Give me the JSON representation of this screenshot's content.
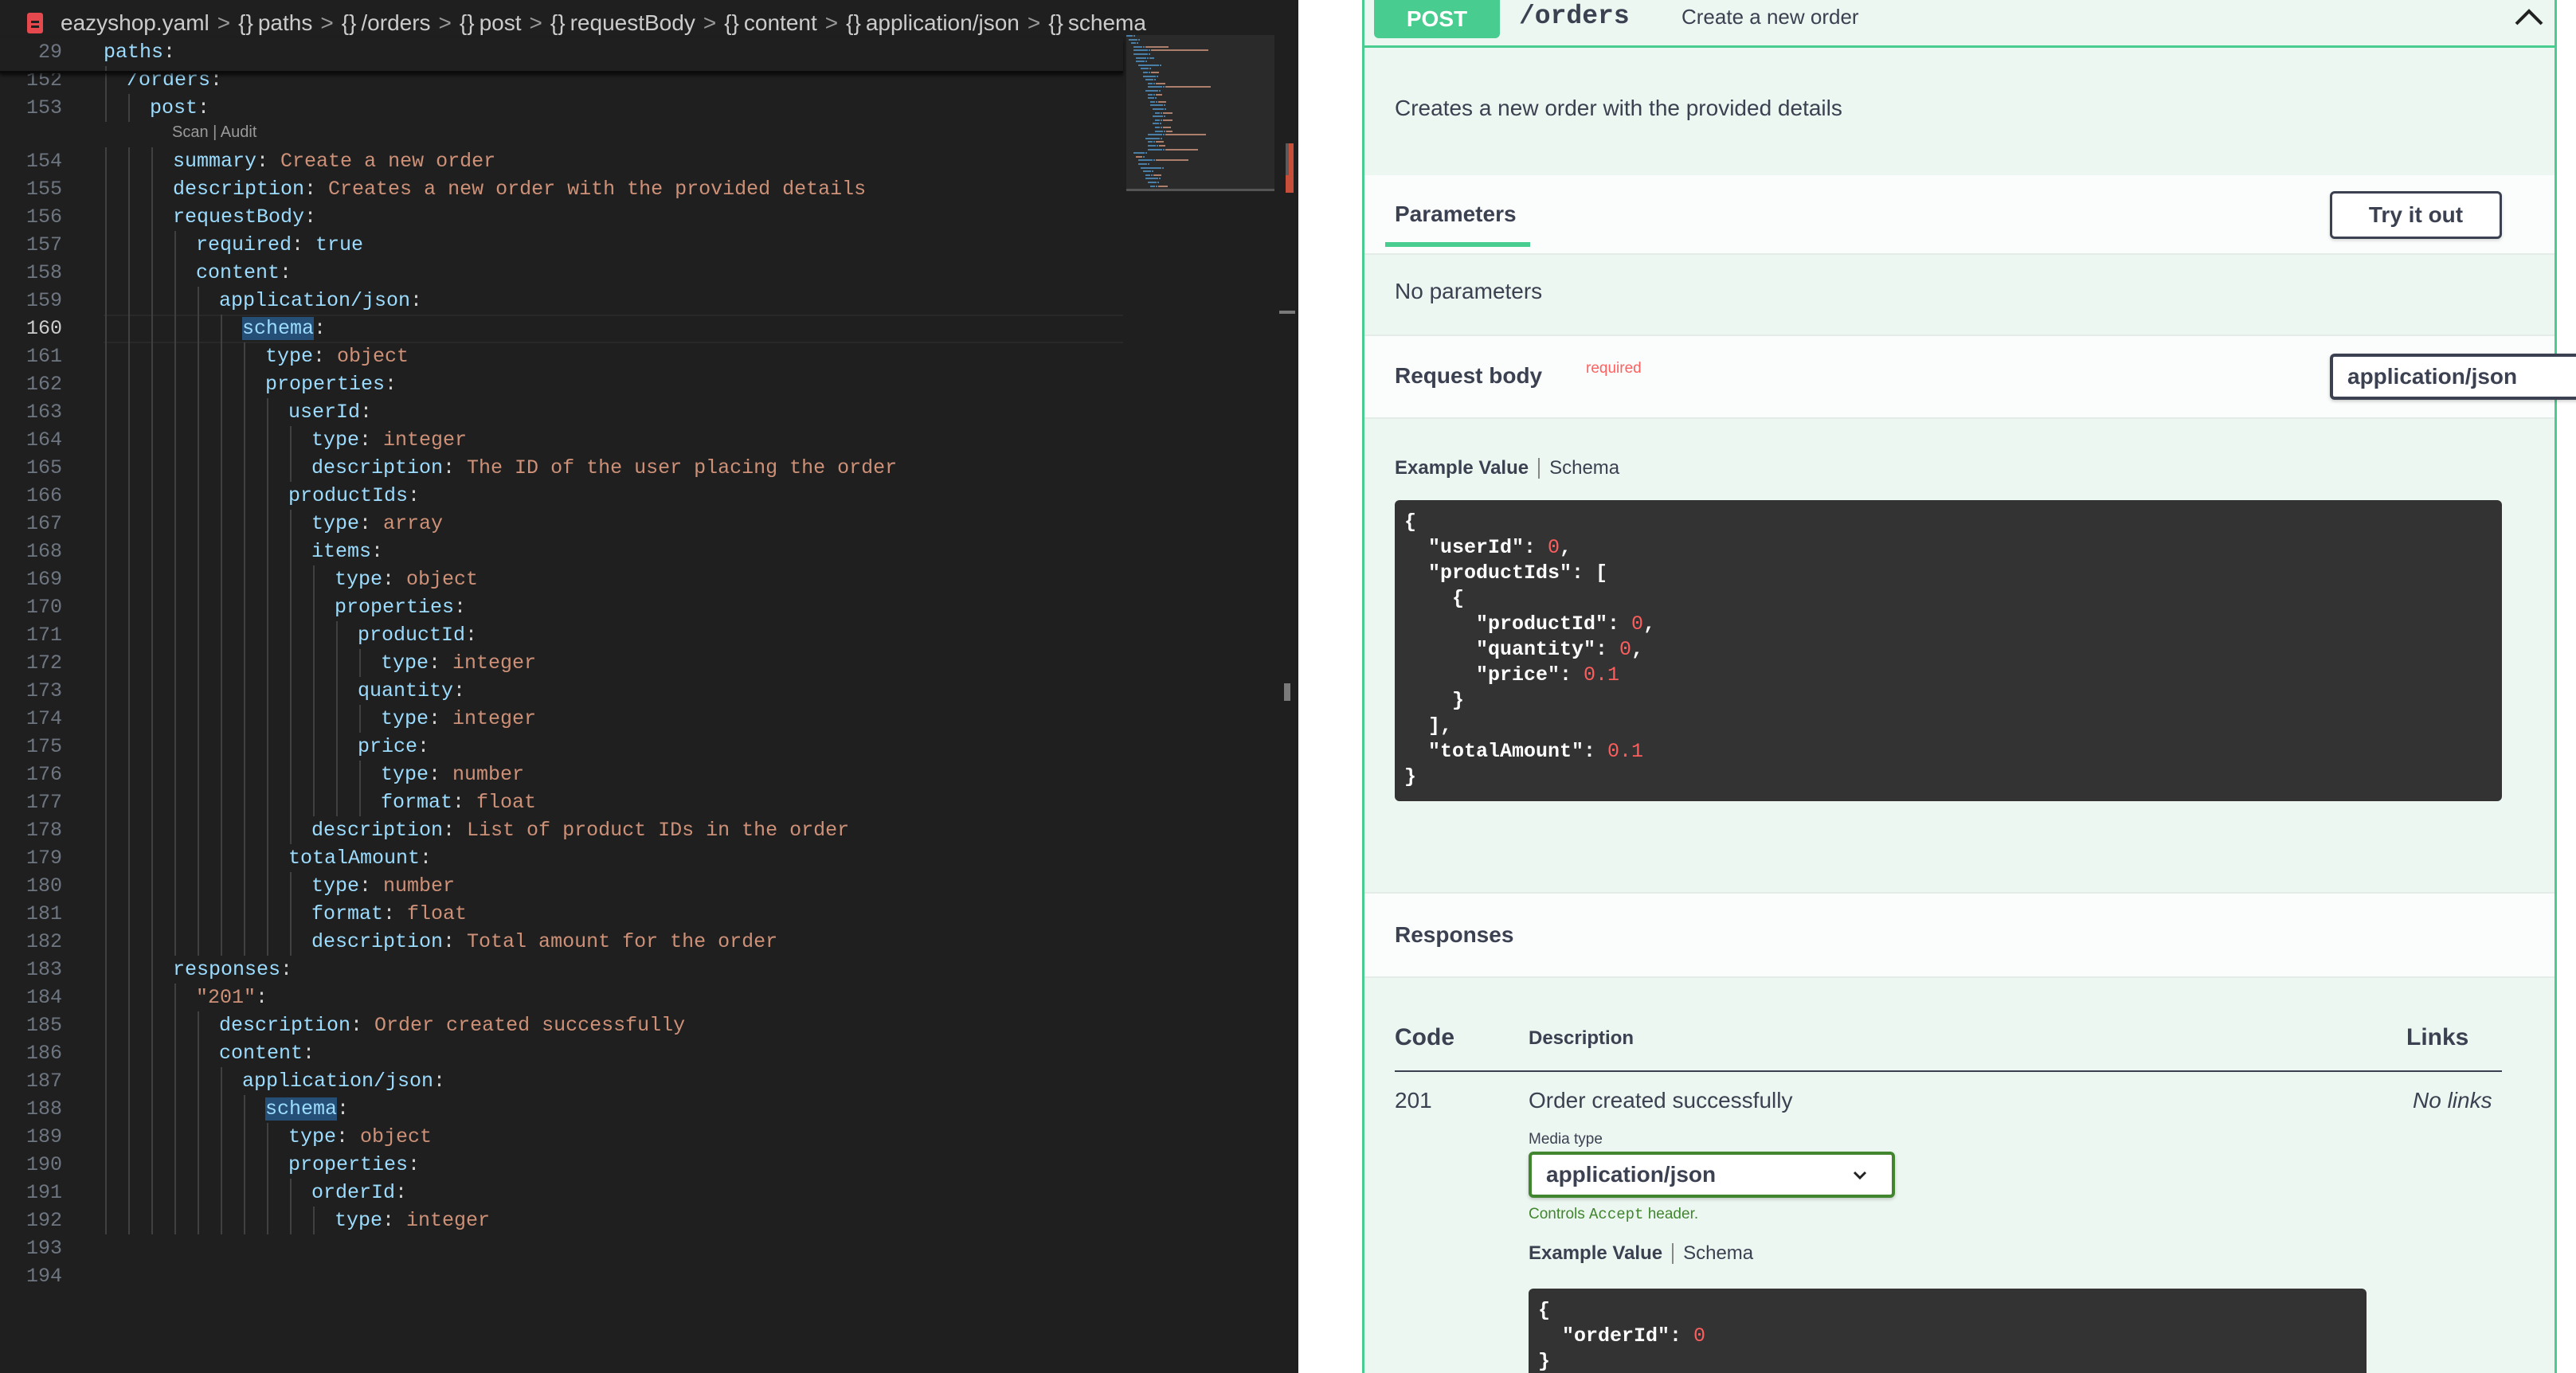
{
  "breadcrumb": {
    "file": "eazyshop.yaml",
    "items": [
      "paths",
      "/orders",
      "post",
      "requestBody",
      "content",
      "application/json",
      "schema"
    ]
  },
  "code_lens": "Scan | Audit",
  "editor_lines": [
    {
      "num": "29",
      "indent": 0,
      "segments": [
        [
          "k",
          "paths"
        ],
        [
          "p",
          ":"
        ]
      ]
    },
    {
      "num": "152",
      "indent": 1,
      "segments": [
        [
          "k",
          "/orders"
        ],
        [
          "p",
          ":"
        ]
      ]
    },
    {
      "num": "153",
      "indent": 2,
      "segments": [
        [
          "k",
          "post"
        ],
        [
          "p",
          ":"
        ]
      ]
    },
    {
      "num": "154",
      "indent": 3,
      "segments": [
        [
          "k",
          "summary"
        ],
        [
          "p",
          ": "
        ],
        [
          "v",
          "Create a new order"
        ]
      ]
    },
    {
      "num": "155",
      "indent": 3,
      "segments": [
        [
          "k",
          "description"
        ],
        [
          "p",
          ": "
        ],
        [
          "v",
          "Creates a new order with the provided details"
        ]
      ]
    },
    {
      "num": "156",
      "indent": 3,
      "segments": [
        [
          "k",
          "requestBody"
        ],
        [
          "p",
          ":"
        ]
      ]
    },
    {
      "num": "157",
      "indent": 4,
      "segments": [
        [
          "k",
          "required"
        ],
        [
          "p",
          ": "
        ],
        [
          "k",
          "true"
        ]
      ]
    },
    {
      "num": "158",
      "indent": 4,
      "segments": [
        [
          "k",
          "content"
        ],
        [
          "p",
          ":"
        ]
      ]
    },
    {
      "num": "159",
      "indent": 5,
      "segments": [
        [
          "k",
          "application/json"
        ],
        [
          "p",
          ":"
        ]
      ]
    },
    {
      "num": "160",
      "indent": 6,
      "segments": [
        [
          "ks",
          "schema"
        ],
        [
          "p",
          ":"
        ]
      ],
      "active": true
    },
    {
      "num": "161",
      "indent": 7,
      "segments": [
        [
          "k",
          "type"
        ],
        [
          "p",
          ": "
        ],
        [
          "v",
          "object"
        ]
      ]
    },
    {
      "num": "162",
      "indent": 7,
      "segments": [
        [
          "k",
          "properties"
        ],
        [
          "p",
          ":"
        ]
      ]
    },
    {
      "num": "163",
      "indent": 8,
      "segments": [
        [
          "k",
          "userId"
        ],
        [
          "p",
          ":"
        ]
      ]
    },
    {
      "num": "164",
      "indent": 9,
      "segments": [
        [
          "k",
          "type"
        ],
        [
          "p",
          ": "
        ],
        [
          "v",
          "integer"
        ]
      ]
    },
    {
      "num": "165",
      "indent": 9,
      "segments": [
        [
          "k",
          "description"
        ],
        [
          "p",
          ": "
        ],
        [
          "v",
          "The ID of the user placing the order"
        ]
      ]
    },
    {
      "num": "166",
      "indent": 8,
      "segments": [
        [
          "k",
          "productIds"
        ],
        [
          "p",
          ":"
        ]
      ]
    },
    {
      "num": "167",
      "indent": 9,
      "segments": [
        [
          "k",
          "type"
        ],
        [
          "p",
          ": "
        ],
        [
          "v",
          "array"
        ]
      ]
    },
    {
      "num": "168",
      "indent": 9,
      "segments": [
        [
          "k",
          "items"
        ],
        [
          "p",
          ":"
        ]
      ]
    },
    {
      "num": "169",
      "indent": 10,
      "segments": [
        [
          "k",
          "type"
        ],
        [
          "p",
          ": "
        ],
        [
          "v",
          "object"
        ]
      ]
    },
    {
      "num": "170",
      "indent": 10,
      "segments": [
        [
          "k",
          "properties"
        ],
        [
          "p",
          ":"
        ]
      ]
    },
    {
      "num": "171",
      "indent": 11,
      "segments": [
        [
          "k",
          "productId"
        ],
        [
          "p",
          ":"
        ]
      ]
    },
    {
      "num": "172",
      "indent": 12,
      "segments": [
        [
          "k",
          "type"
        ],
        [
          "p",
          ": "
        ],
        [
          "v",
          "integer"
        ]
      ]
    },
    {
      "num": "173",
      "indent": 11,
      "segments": [
        [
          "k",
          "quantity"
        ],
        [
          "p",
          ":"
        ]
      ]
    },
    {
      "num": "174",
      "indent": 12,
      "segments": [
        [
          "k",
          "type"
        ],
        [
          "p",
          ": "
        ],
        [
          "v",
          "integer"
        ]
      ]
    },
    {
      "num": "175",
      "indent": 11,
      "segments": [
        [
          "k",
          "price"
        ],
        [
          "p",
          ":"
        ]
      ]
    },
    {
      "num": "176",
      "indent": 12,
      "segments": [
        [
          "k",
          "type"
        ],
        [
          "p",
          ": "
        ],
        [
          "v",
          "number"
        ]
      ]
    },
    {
      "num": "177",
      "indent": 12,
      "segments": [
        [
          "k",
          "format"
        ],
        [
          "p",
          ": "
        ],
        [
          "v",
          "float"
        ]
      ]
    },
    {
      "num": "178",
      "indent": 9,
      "segments": [
        [
          "k",
          "description"
        ],
        [
          "p",
          ": "
        ],
        [
          "v",
          "List of product IDs in the order"
        ]
      ]
    },
    {
      "num": "179",
      "indent": 8,
      "segments": [
        [
          "k",
          "totalAmount"
        ],
        [
          "p",
          ":"
        ]
      ]
    },
    {
      "num": "180",
      "indent": 9,
      "segments": [
        [
          "k",
          "type"
        ],
        [
          "p",
          ": "
        ],
        [
          "v",
          "number"
        ]
      ]
    },
    {
      "num": "181",
      "indent": 9,
      "segments": [
        [
          "k",
          "format"
        ],
        [
          "p",
          ": "
        ],
        [
          "v",
          "float"
        ]
      ]
    },
    {
      "num": "182",
      "indent": 9,
      "segments": [
        [
          "k",
          "description"
        ],
        [
          "p",
          ": "
        ],
        [
          "v",
          "Total amount for the order"
        ]
      ]
    },
    {
      "num": "183",
      "indent": 3,
      "segments": [
        [
          "k",
          "responses"
        ],
        [
          "p",
          ":"
        ]
      ]
    },
    {
      "num": "184",
      "indent": 4,
      "segments": [
        [
          "v",
          "\"201\""
        ],
        [
          "p",
          ":"
        ]
      ]
    },
    {
      "num": "185",
      "indent": 5,
      "segments": [
        [
          "k",
          "description"
        ],
        [
          "p",
          ": "
        ],
        [
          "v",
          "Order created successfully"
        ]
      ]
    },
    {
      "num": "186",
      "indent": 5,
      "segments": [
        [
          "k",
          "content"
        ],
        [
          "p",
          ":"
        ]
      ]
    },
    {
      "num": "187",
      "indent": 6,
      "segments": [
        [
          "k",
          "application/json"
        ],
        [
          "p",
          ":"
        ]
      ]
    },
    {
      "num": "188",
      "indent": 7,
      "segments": [
        [
          "ks",
          "schema"
        ],
        [
          "p",
          ":"
        ]
      ]
    },
    {
      "num": "189",
      "indent": 8,
      "segments": [
        [
          "k",
          "type"
        ],
        [
          "p",
          ": "
        ],
        [
          "v",
          "object"
        ]
      ]
    },
    {
      "num": "190",
      "indent": 8,
      "segments": [
        [
          "k",
          "properties"
        ],
        [
          "p",
          ":"
        ]
      ]
    },
    {
      "num": "191",
      "indent": 9,
      "segments": [
        [
          "k",
          "orderId"
        ],
        [
          "p",
          ":"
        ]
      ]
    },
    {
      "num": "192",
      "indent": 10,
      "segments": [
        [
          "k",
          "type"
        ],
        [
          "p",
          ": "
        ],
        [
          "v",
          "integer"
        ]
      ]
    },
    {
      "num": "193",
      "indent": 0,
      "segments": []
    },
    {
      "num": "194",
      "indent": 0,
      "segments": []
    }
  ],
  "swagger": {
    "method": "POST",
    "path": "/orders",
    "summary": "Create a new order",
    "description": "Creates a new order with the provided details",
    "parameters_tab": "Parameters",
    "try_button": "Try it out",
    "no_parameters": "No parameters",
    "request_body_title": "Request body",
    "request_body_required": "required",
    "request_media_type": "application/json",
    "example_value_tab": "Example Value",
    "schema_tab": "Schema",
    "request_example": [
      [
        [
          "s",
          "{"
        ]
      ],
      [
        [
          "s",
          "  \"userId\": "
        ],
        [
          "n",
          "0"
        ],
        [
          "s",
          ","
        ]
      ],
      [
        [
          "s",
          "  \"productIds\": ["
        ]
      ],
      [
        [
          "s",
          "    {"
        ]
      ],
      [
        [
          "s",
          "      \"productId\": "
        ],
        [
          "n",
          "0"
        ],
        [
          "s",
          ","
        ]
      ],
      [
        [
          "s",
          "      \"quantity\": "
        ],
        [
          "n",
          "0"
        ],
        [
          "s",
          ","
        ]
      ],
      [
        [
          "s",
          "      \"price\": "
        ],
        [
          "n",
          "0.1"
        ]
      ],
      [
        [
          "s",
          "    }"
        ]
      ],
      [
        [
          "s",
          "  ],"
        ]
      ],
      [
        [
          "s",
          "  \"totalAmount\": "
        ],
        [
          "n",
          "0.1"
        ]
      ],
      [
        [
          "s",
          "}"
        ]
      ]
    ],
    "responses_title": "Responses",
    "table_headers": {
      "code": "Code",
      "description": "Description",
      "links": "Links"
    },
    "response": {
      "code": "201",
      "description": "Order created successfully",
      "links": "No links",
      "media_type_label": "Media type",
      "media_type": "application/json",
      "controls_note_pre": "Controls ",
      "controls_note_code": "Accept",
      "controls_note_post": " header."
    },
    "response_example": [
      [
        [
          "s",
          "{"
        ]
      ],
      [
        [
          "s",
          "  \"orderId\": "
        ],
        [
          "n",
          "0"
        ]
      ],
      [
        [
          "s",
          "}"
        ]
      ]
    ]
  },
  "colors": {
    "post_green": "#49cc90",
    "editor_bg": "#1f1f1f",
    "key_blue": "#9cdcfe",
    "value_orange": "#ce9178"
  }
}
